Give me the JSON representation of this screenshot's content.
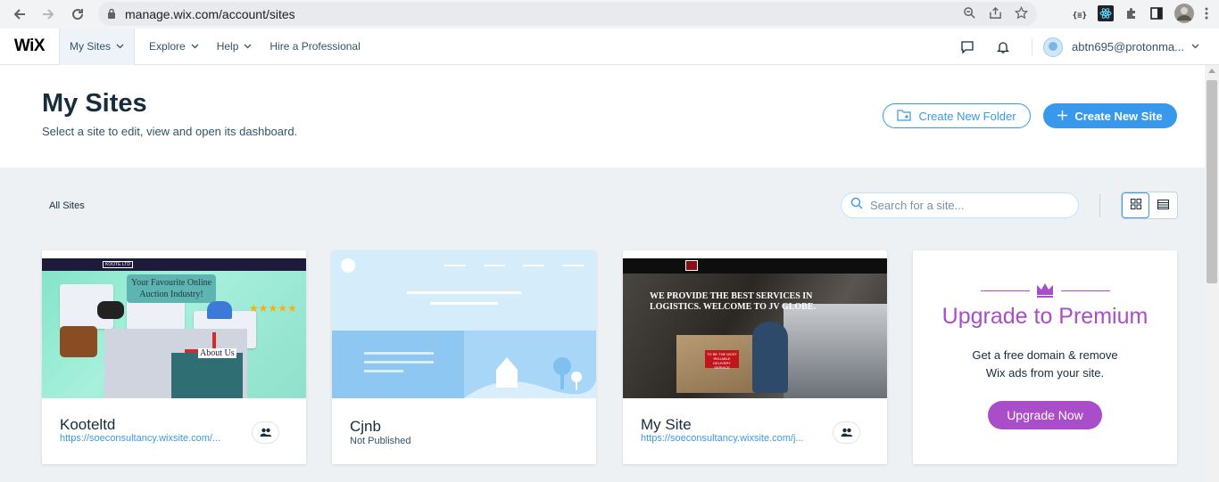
{
  "browser": {
    "url": "manage.wix.com/account/sites"
  },
  "wix_nav": {
    "logo": "WiX",
    "items": [
      {
        "label": "My Sites"
      },
      {
        "label": "Explore"
      },
      {
        "label": "Help"
      },
      {
        "label": "Hire a Professional"
      }
    ],
    "account_email": "abtn695@protonma..."
  },
  "header": {
    "title": "My Sites",
    "subtitle": "Select a site to edit, view and open its dashboard.",
    "create_folder_label": "Create New Folder",
    "create_site_label": "Create New Site"
  },
  "toolbar": {
    "all_sites_label": "All Sites",
    "search_placeholder": "Search for a site..."
  },
  "sites": [
    {
      "name": "Kooteltd",
      "url": "https://soeconsultancy.wixsite.com/...",
      "thumb": {
        "banner": "Your Favourite Online Auction Industry!",
        "about": "About Us",
        "brand": "KOOTE LTD"
      }
    },
    {
      "name": "Cjnb",
      "status": "Not Published"
    },
    {
      "name": "My Site",
      "url": "https://soeconsultancy.wixsite.com/j...",
      "thumb": {
        "headline": "WE PROVIDE THE BEST SERVICES IN LOGISTICS. WELCOME TO JV GLOBE.",
        "badge": "TO BE THE MOST RELIABLE DELIVERY SERVICE"
      }
    }
  ],
  "premium": {
    "title": "Upgrade to Premium",
    "line1": "Get a free domain & remove",
    "line2": "Wix ads from your site.",
    "button_label": "Upgrade Now"
  },
  "colors": {
    "wix_blue": "#3899ec",
    "premium_purple": "#aa4dc8",
    "text_dark": "#162d3d"
  }
}
